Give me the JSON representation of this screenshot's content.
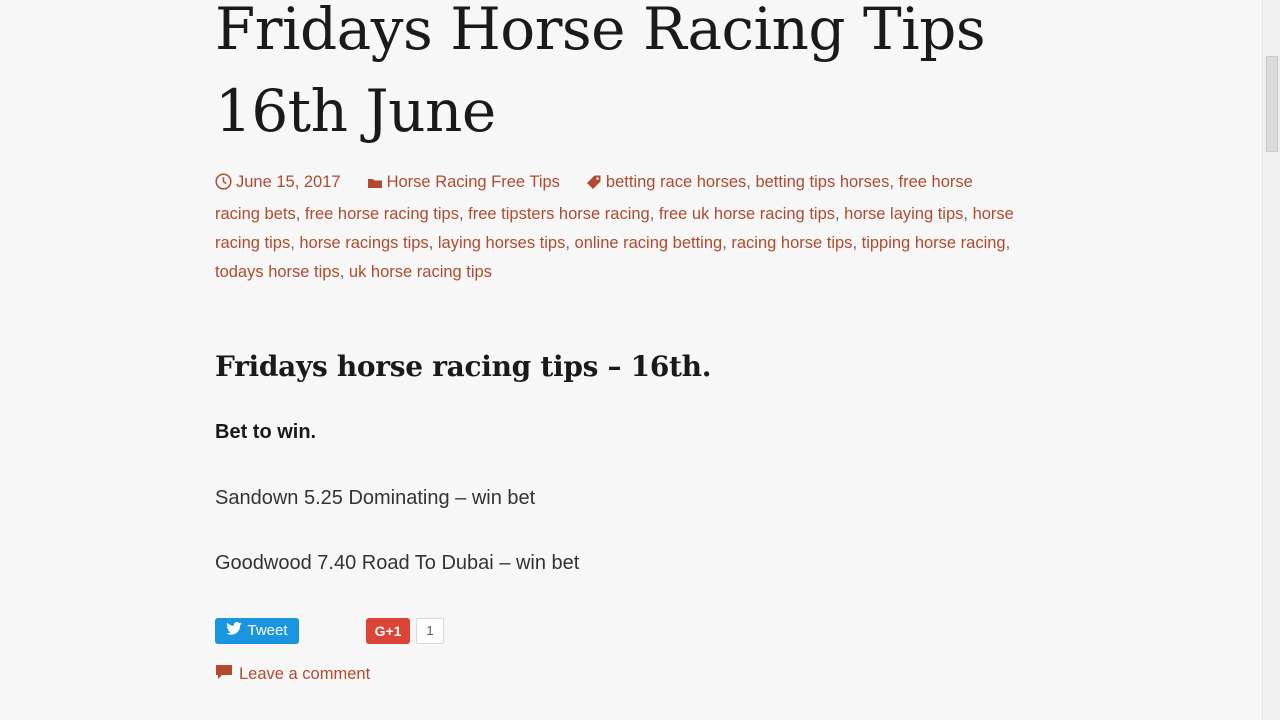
{
  "post": {
    "title_line1": "Fridays Horse Racing Tips",
    "title_line2": "16th June",
    "date": "June 15, 2017",
    "category": "Horse Racing Free Tips",
    "tags": [
      "betting race horses",
      "betting tips horses",
      "free horse racing bets",
      "free horse racing tips",
      "free tipsters horse racing",
      "free uk horse racing tips",
      "horse laying tips",
      "horse racing tips",
      "horse racings tips",
      "laying horses tips",
      "online racing betting",
      "racing horse tips",
      "tipping horse racing",
      "todays horse tips",
      "uk horse racing tips"
    ],
    "heading": "Fridays horse racing tips – 16th.",
    "bet_label": "Bet to win.",
    "tips": [
      "Sandown 5.25 Dominating – win bet",
      "Goodwood 7.40 Road To Dubai – win bet"
    ]
  },
  "share": {
    "tweet_label": "Tweet",
    "gplus_label": "G+1",
    "gplus_count": "1"
  },
  "comments": {
    "leave_label": "Leave a comment"
  },
  "icons": {
    "date": "clock-icon",
    "category": "folder-icon",
    "tags": "tag-icon",
    "tweet": "twitter-bird-icon",
    "comment": "comment-bubble-icon"
  },
  "colors": {
    "link": "#b14a2e",
    "tweet_bg": "#1b95e0",
    "gplus_bg": "#db4437",
    "page_bg": "#f7f7f7"
  }
}
